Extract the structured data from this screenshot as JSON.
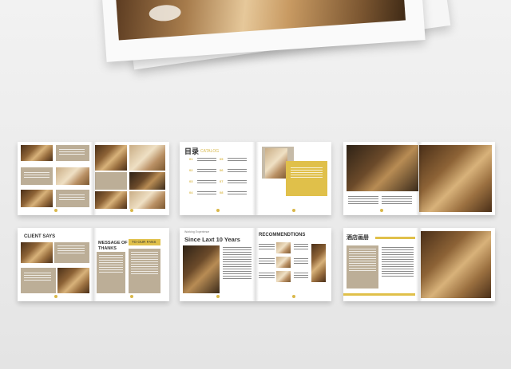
{
  "spread2": {
    "title": "目录",
    "subtitle": "CATALOG",
    "numbers": [
      "01",
      "02",
      "03",
      "04",
      "05",
      "06",
      "07",
      "08"
    ]
  },
  "spread4": {
    "client_says": "CLIENT SAYS",
    "message_title": "MESSAGE OF THANKS",
    "to_our_fans": "TO OUR FANS",
    "to_customers": "TO OUR CUSTOMER"
  },
  "spread5": {
    "kicker": "Working Experience",
    "heading": "Since Laxt 10 Years",
    "recommend": "RECOMMENDTIONS"
  },
  "spread6": {
    "heading": "酒店画册"
  }
}
